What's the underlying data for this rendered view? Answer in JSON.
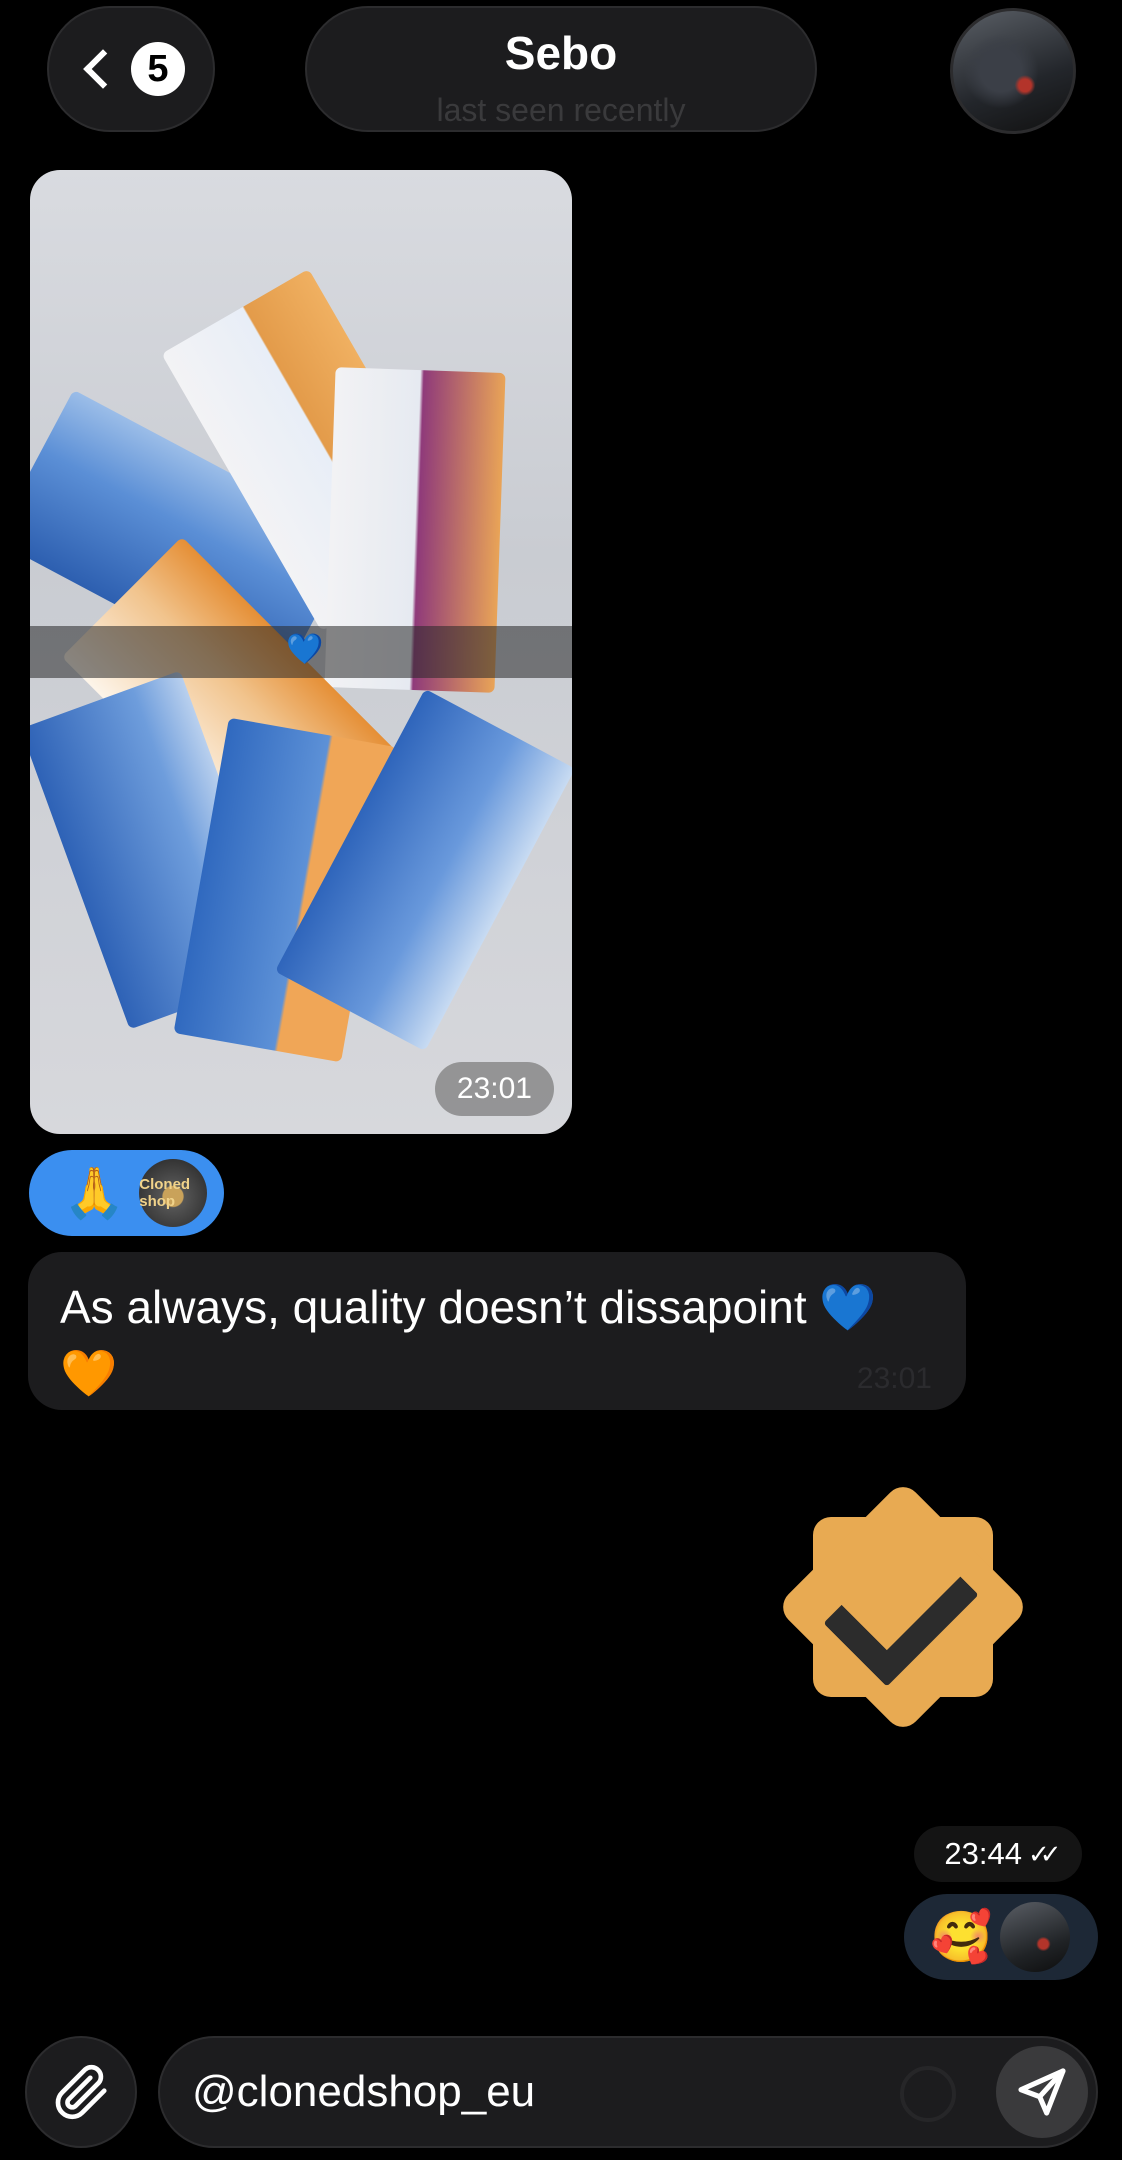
{
  "header": {
    "unread_count": "5",
    "contact_name": "Sebo",
    "contact_status": "last seen recently"
  },
  "messages": {
    "photo": {
      "time": "23:01",
      "overlay_emoji": "💙"
    },
    "photo_reaction": {
      "emoji": "🙏",
      "avatar_text": "Cloned shop"
    },
    "text": {
      "body": "As always, quality doesn’t dissapoint 💙 🧡",
      "time": "23:01"
    },
    "sticker": {
      "icon": "verified-check-badge",
      "color": "#e8aa52"
    },
    "sent": {
      "time": "23:44",
      "ticks": "✓✓"
    },
    "sent_reaction": {
      "emoji": "🥰"
    }
  },
  "composer": {
    "value": "@clonedshop_eu"
  },
  "colors": {
    "background": "#000000",
    "bubble": "#1c1c1e",
    "reaction_blue": "#3b8ff0",
    "accent_orange": "#e8aa52"
  }
}
